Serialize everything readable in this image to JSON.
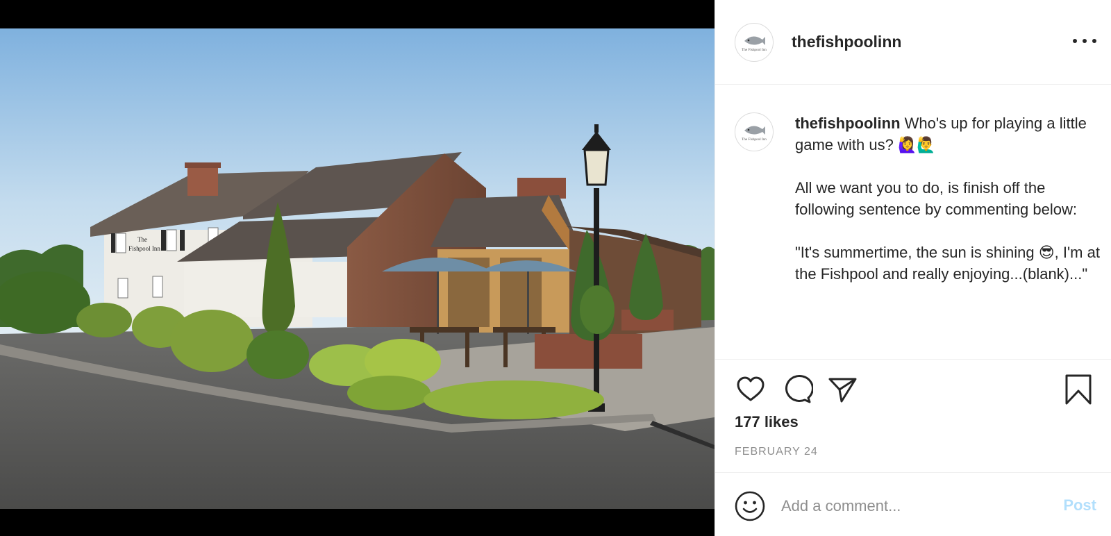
{
  "media": {
    "sign_line1": "The",
    "sign_line2": "Fishpool Inn"
  },
  "header": {
    "username": "thefishpoolinn",
    "avatar_logo_text": "The Fishpool Inn",
    "more_icon": "more-horizontal-icon"
  },
  "caption": {
    "username": "thefishpoolinn",
    "line1": " Who's up for playing a little game with us? 🙋‍♀️🙋‍♂️",
    "paragraph2": "All we want you to do, is finish off the following sentence by commenting below:",
    "paragraph3": "\"It's summertime, the sun is shining 😎, I'm at the Fishpool and really enjoying...(blank)...\""
  },
  "actions": {
    "like_icon": "heart-icon",
    "comment_icon": "comment-icon",
    "share_icon": "paper-plane-icon",
    "save_icon": "bookmark-icon"
  },
  "likes": "177 likes",
  "date": "FEBRUARY 24",
  "comment": {
    "emoji_icon": "smiley-icon",
    "placeholder": "Add a comment...",
    "post_label": "Post",
    "post_color": "#b2dffc"
  }
}
